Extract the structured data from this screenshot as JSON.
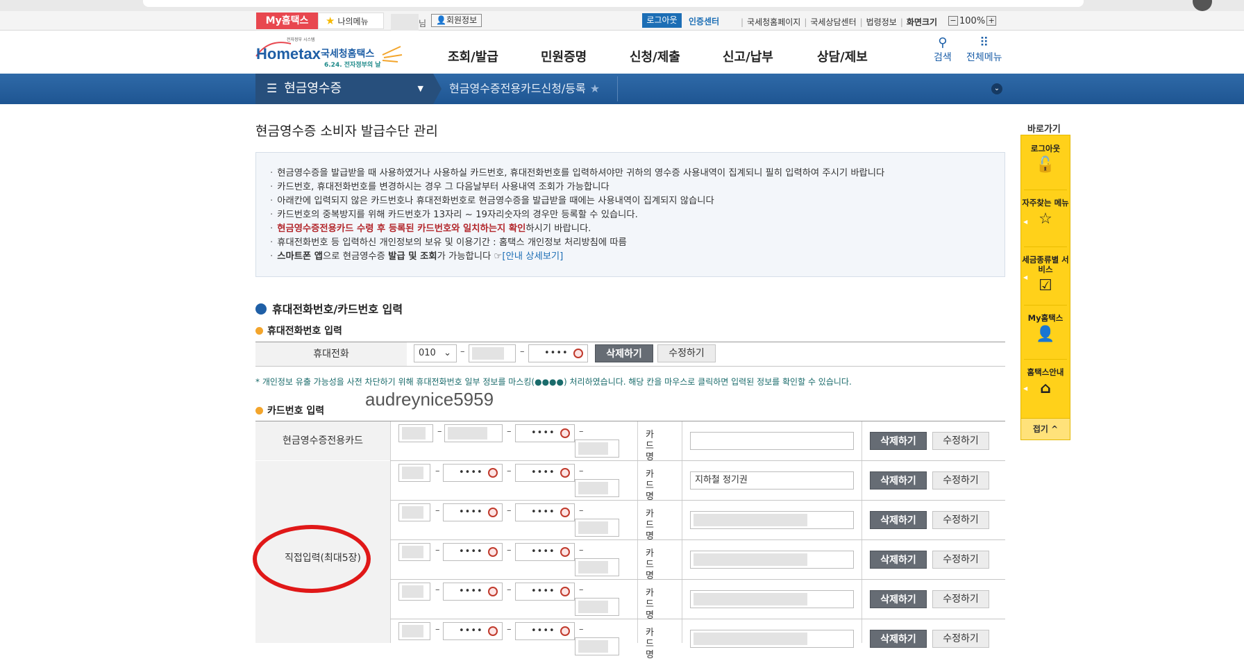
{
  "util_bar": {
    "my_hometax": "My홈택스",
    "my_menu": "나의메뉴",
    "name_suffix": "님",
    "member_info": "회원정보",
    "logout": "로그아웃",
    "cert_center": "인증센터",
    "links": [
      "국세청홈페이지",
      "국세상담센터",
      "법령정보",
      "화면크기"
    ],
    "zoom_minus": "−",
    "zoom_value": "100%",
    "zoom_plus": "+"
  },
  "header": {
    "logo_small": "전자정부 시스템",
    "logo_main": "Hometax",
    "logo_sub": "국세청홈택스",
    "logo_event": "6.24. 전자정부의 날",
    "gnb": [
      "조회/발급",
      "민원증명",
      "신청/제출",
      "신고/납부",
      "상담/제보"
    ],
    "search_label": "검색",
    "all_menu_label": "전체메뉴"
  },
  "navbar": {
    "menu_title": "현금영수증",
    "breadcrumb": "현금영수증전용카드신청/등록"
  },
  "page": {
    "title": "현금영수증 소비자 발급수단 관리",
    "info": [
      {
        "text": "현금영수증을 발급받을 때 사용하였거나 사용하실 카드번호, 휴대전화번호를 입력하셔야만 귀하의 영수증 사용내역이 집계되니 필히 입력하여 주시기 바랍니다"
      },
      {
        "text": "카드번호, 휴대전화번호를 변경하시는 경우 그 다음날부터 사용내역 조회가 가능합니다"
      },
      {
        "text": "아래칸에 입력되지 않은 카드번호나 휴대전화번호로 현금영수증을 발급받을 때에는 사용내역이 집계되지 않습니다"
      },
      {
        "text": "카드번호의 중복방지를 위해 카드번호가 13자리 ~ 19자리숫자의 경우만 등록할 수 있습니다."
      },
      {
        "red": "현금영수증전용카드 수령 후 등록된 카드번호와 일치하는지 확인",
        "rest": "하시기 바랍니다."
      },
      {
        "text": "휴대전화번호 등 입력하신 개인정보의 보유 및 이용기간 : 홈택스 개인정보 처리방침에 따름"
      },
      {
        "b1": "스마트폰 앱",
        "t1": "으로 현금영수증 ",
        "b2": "발급 및 조회",
        "t2": "가 가능합니다 ",
        "hand": "☞",
        "link": "[안내 상세보기]"
      }
    ],
    "section_title": "휴대전화번호/카드번호 입력",
    "phone_sub": "휴대전화번호 입력",
    "phone_label": "휴대전화",
    "phone_prefix": "010",
    "masked": "••••",
    "delete": "삭제하기",
    "modify": "수정하기",
    "notice": "* 개인정보 유출 가능성을 사전 차단하기 위해 휴대전화번호 일부 정보를 마스킹(●●●●) 처리하였습니다. 해당 칸을 마우스로 클릭하면 입력된 정보를 확인할 수 있습니다.",
    "watermark": "audreynice5959",
    "card_sub": "카드번호 입력",
    "dedicated_label": "현금영수증전용카드",
    "direct_label": "직접입력(최대5장)",
    "card_name_label": "카드명",
    "card_names": [
      "",
      "지하철 정기권",
      "",
      "",
      "",
      ""
    ]
  },
  "quick": {
    "title": "바로가기",
    "items": [
      {
        "label": "로그아웃",
        "icon": "lock-icon"
      },
      {
        "label": "자주찾는 메뉴",
        "icon": "star-icon"
      },
      {
        "label": "세금종류별 서비스",
        "icon": "checkbox-icon"
      },
      {
        "label": "My홈택스",
        "icon": "person-icon"
      },
      {
        "label": "홈택스안내",
        "icon": "home-icon"
      }
    ],
    "fold": "접기 ^"
  }
}
